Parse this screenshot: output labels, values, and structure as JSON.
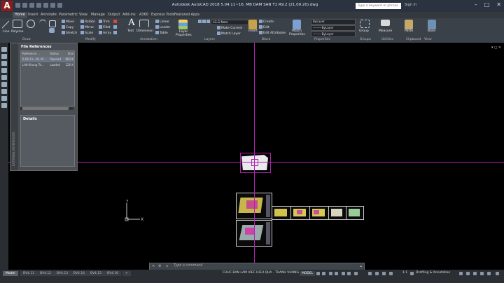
{
  "app": {
    "logo": "A",
    "title": "Autodesk AutoCAD 2018   5.04.11~16. MB DAM SAN T1 R9.2 (21.09.20).dwg",
    "search_placeholder": "Type a keyword or phrase",
    "sign_in": "Sign In",
    "win_controls": [
      "–",
      "□",
      "✕"
    ]
  },
  "tabs": [
    "Home",
    "Insert",
    "Annotate",
    "Parametric",
    "View",
    "Manage",
    "Output",
    "Add-ins",
    "A360",
    "Express Tools",
    "Featured Apps"
  ],
  "ribbon": {
    "draw": {
      "line": "Line",
      "polyline": "Polyline",
      "label": "Draw"
    },
    "modify": {
      "move": "Move",
      "copy": "Copy",
      "rotate": "Rotate",
      "mirror": "Mirror",
      "stretch": "Stretch",
      "trim": "Trim",
      "fillet": "Fillet",
      "array": "Array",
      "scale": "Scale",
      "label": "Modify"
    },
    "annotation": {
      "text": "Text",
      "dimension": "Dimension",
      "linear": "Linear",
      "leader": "Leader",
      "table": "Table",
      "label": "Annotation"
    },
    "layers": {
      "layer_properties": "Layer Properties",
      "layer_value": "LG.G.Note",
      "make_current": "Make Current",
      "match_layer": "Match Layer",
      "label": "Layers"
    },
    "block": {
      "insert": "Insert",
      "create": "Create",
      "edit": "Edit",
      "edit_attributes": "Edit Attributes",
      "label": "Block"
    },
    "properties": {
      "match_properties": "Match Properties",
      "bylayer_1": "ByLayer",
      "bylayer_2": "———ByLayer",
      "bylayer_3": "———ByLayer",
      "label": "Properties"
    },
    "groups": {
      "group": "Group",
      "label": "Groups"
    },
    "utilities": {
      "measure": "Measure",
      "label": "Utilities"
    },
    "clipboard": {
      "paste": "Paste",
      "label": "Clipboard"
    },
    "view": {
      "base": "Base",
      "label": "View"
    }
  },
  "xref_palette": {
    "side_title": "EXTERNAL REFERENCES",
    "file_references": "File References",
    "columns": [
      "Reference ...",
      "Status",
      "Size"
    ],
    "rows": [
      [
        "5.04.11~16. M...",
        "Opened",
        "883 K"
      ],
      [
        "LAK-Khung Te...",
        "Loaded",
        "126 K"
      ]
    ],
    "details": "Details"
  },
  "command": {
    "placeholder": "Type a command"
  },
  "status": {
    "layout_tabs": [
      "Model",
      "BV4.11",
      "BV4.12",
      "BV4.13",
      "BV4.14",
      "BV4.15",
      "BV4.16"
    ],
    "marquee": "CHUC BAN LAM VIEC HIEU QUA - THANH VUONG",
    "model": "MODEL",
    "scale": "1:1",
    "workspace": "Drafting & Annotation"
  },
  "colors": {
    "crosshair": "#b022b0",
    "ribbon": "#3b4149",
    "background": "#000000"
  }
}
